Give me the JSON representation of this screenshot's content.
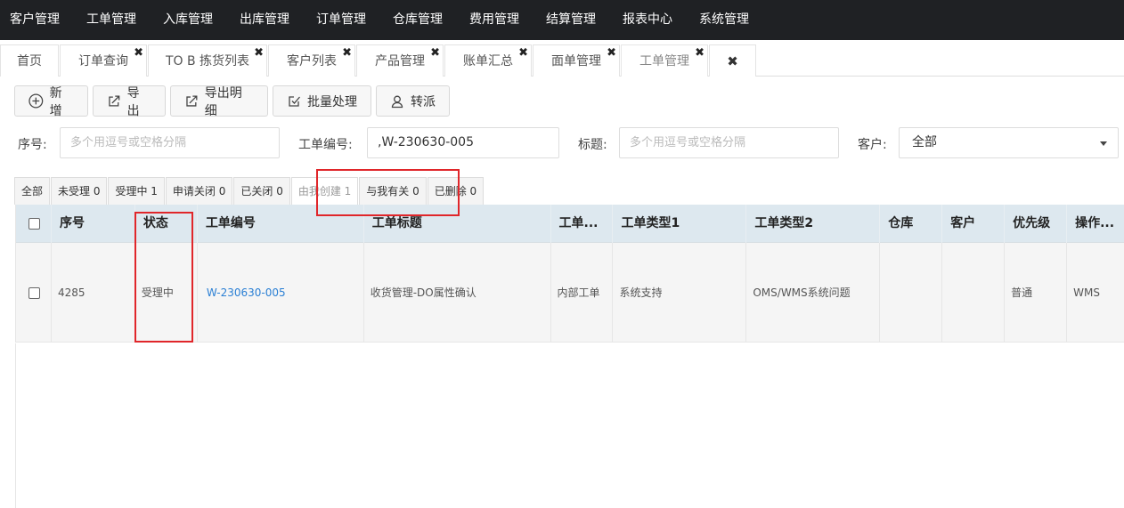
{
  "topnav": [
    "客户管理",
    "工单管理",
    "入库管理",
    "出库管理",
    "订单管理",
    "仓库管理",
    "费用管理",
    "结算管理",
    "报表中心",
    "系统管理"
  ],
  "tabs": [
    {
      "label": "首页",
      "closable": false
    },
    {
      "label": "订单查询",
      "closable": true
    },
    {
      "label": "TO B 拣货列表",
      "closable": true
    },
    {
      "label": "客户列表",
      "closable": true
    },
    {
      "label": "产品管理",
      "closable": true
    },
    {
      "label": "账单汇总",
      "closable": true
    },
    {
      "label": "面单管理",
      "closable": true
    },
    {
      "label": "工单管理",
      "closable": true,
      "active": true
    }
  ],
  "close_symbol": "✖",
  "toolbar": {
    "add": "新增",
    "export": "导出",
    "export_detail": "导出明细",
    "batch": "批量处理",
    "transfer": "转派"
  },
  "search": {
    "seq_label": "序号:",
    "seq_placeholder": "多个用逗号或空格分隔",
    "ticket_no_label": "工单编号:",
    "ticket_no_value": ",W-230630-005",
    "title_label": "标题:",
    "title_placeholder": "多个用逗号或空格分隔",
    "customer_label": "客户:",
    "customer_value": "全部"
  },
  "filter_tabs": [
    "全部",
    "未受理 0",
    "受理中 1",
    "申请关闭 0",
    "已关闭 0",
    "由我创建 1",
    "与我有关 0",
    "已删除 0"
  ],
  "table": {
    "headers": [
      "序号",
      "状态",
      "工单编号",
      "工单标题",
      "工单...",
      "工单类型1",
      "工单类型2",
      "仓库",
      "客户",
      "优先级",
      "操作..."
    ],
    "rows": [
      [
        "4285",
        "受理中",
        "W-230630-005",
        "收货管理-DO属性确认",
        "内部工单",
        "系统支持",
        "OMS/WMS系统问题",
        "",
        "",
        "普通",
        "WMS"
      ]
    ]
  },
  "colors": {
    "topnav_bg": "#1f2124",
    "header_bg": "#dde8ef",
    "link": "#2a7fd4",
    "highlight_box": "#e0262a"
  }
}
